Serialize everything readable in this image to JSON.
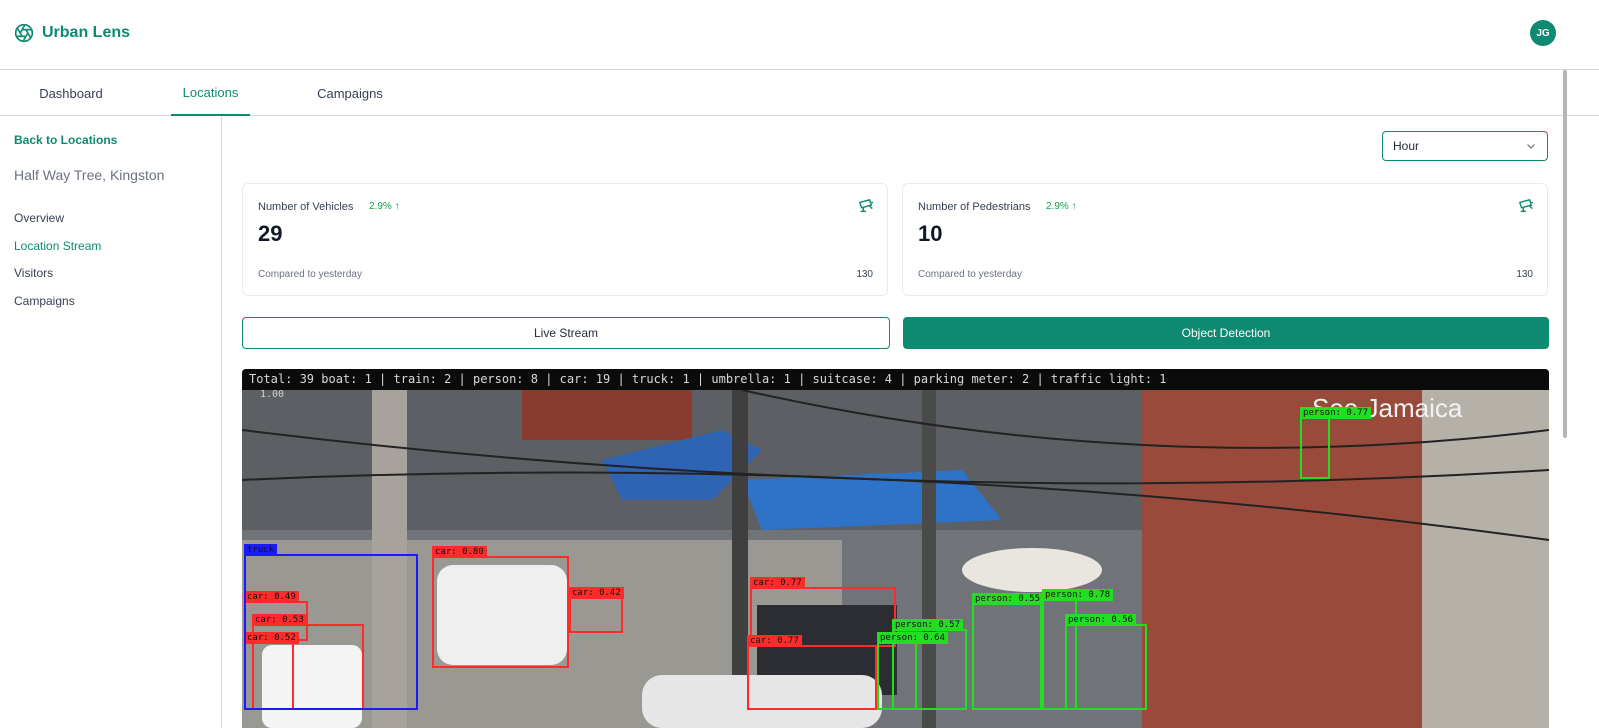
{
  "app": {
    "name": "Urban Lens",
    "accent": "#0f8a72",
    "user_initials": "JG"
  },
  "tabs": [
    {
      "label": "Dashboard",
      "active": false
    },
    {
      "label": "Locations",
      "active": true
    },
    {
      "label": "Campaigns",
      "active": false
    }
  ],
  "sidebar": {
    "back_label": "Back to Locations",
    "location_title": "Half Way Tree, Kingston",
    "items": [
      {
        "label": "Overview",
        "active": false
      },
      {
        "label": "Location Stream",
        "active": true
      },
      {
        "label": "Visitors",
        "active": false
      },
      {
        "label": "Campaigns",
        "active": false
      }
    ]
  },
  "filter": {
    "selected": "Hour"
  },
  "cards": [
    {
      "label": "Number of Vehicles",
      "delta": "2.9% ↑",
      "value": "29",
      "compare": "Compared to yesterday",
      "total": "130",
      "icon": "cctv-camera-icon"
    },
    {
      "label": "Number of Pedestrians",
      "delta": "2.9% ↑",
      "value": "10",
      "compare": "Compared to yesterday",
      "total": "130",
      "icon": "cctv-camera-icon"
    }
  ],
  "buttons": {
    "live_stream": "Live Stream",
    "object_detection": "Object Detection"
  },
  "stream": {
    "summary": "Total: 39      boat: 1 | train: 2 | person: 8 | car: 19 | truck: 1 | umbrella: 1 | suitcase: 4 | parking meter: 2 | traffic light: 1",
    "fps": "1.00",
    "watermark": "See Jamaica",
    "detections": [
      {
        "cls": "car",
        "label": "car: 0.80"
      },
      {
        "cls": "car",
        "label": "car: 0.42"
      },
      {
        "cls": "car",
        "label": "car: 0.49"
      },
      {
        "cls": "car",
        "label": "car: 0.53"
      },
      {
        "cls": "car",
        "label": "car: 0.52"
      },
      {
        "cls": "car",
        "label": "car: 0.77"
      },
      {
        "cls": "car",
        "label": "car: 0.77"
      },
      {
        "cls": "truck",
        "label": "truck"
      },
      {
        "cls": "person",
        "label": "person: 0.77"
      },
      {
        "cls": "person",
        "label": "person: 0.57"
      },
      {
        "cls": "person",
        "label": "person: 0.64"
      },
      {
        "cls": "person",
        "label": "person: 0.55"
      },
      {
        "cls": "person",
        "label": "person: 0.78"
      },
      {
        "cls": "person",
        "label": "person: 0.56"
      }
    ]
  }
}
